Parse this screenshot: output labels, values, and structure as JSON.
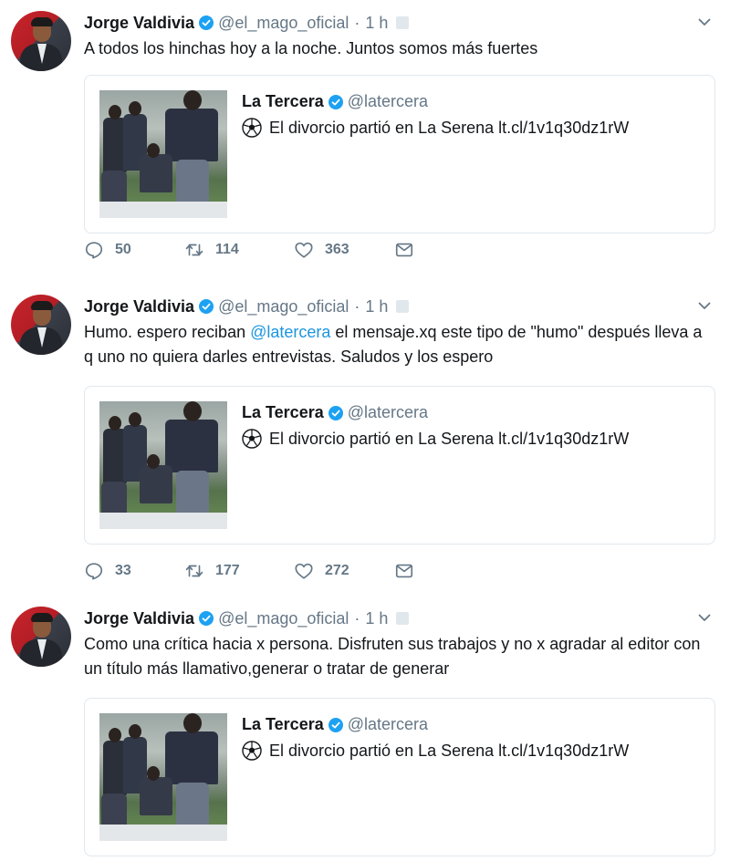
{
  "tweets": [
    {
      "name": "Jorge Valdivia",
      "handle": "@el_mago_oficial",
      "separator": "·",
      "time": "1 h",
      "text": "A todos los hinchas hoy a la noche. Juntos somos más fuertes",
      "card": {
        "name": "La Tercera",
        "handle": "@latercera",
        "text": "El divorcio partió en La Serena lt.cl/1v1q30dz1rW"
      },
      "replies": "50",
      "retweets": "114",
      "likes": "363"
    },
    {
      "name": "Jorge Valdivia",
      "handle": "@el_mago_oficial",
      "separator": "·",
      "time": "1 h",
      "text_before": "Humo. espero reciban ",
      "mention": "@latercera",
      "text_after": " el mensaje.xq este tipo de \"humo\" después lleva a q uno no quiera darles entrevistas. Saludos y los espero",
      "card": {
        "name": "La Tercera",
        "handle": "@latercera",
        "text": "El divorcio partió en La Serena lt.cl/1v1q30dz1rW"
      },
      "replies": "33",
      "retweets": "177",
      "likes": "272"
    },
    {
      "name": "Jorge Valdivia",
      "handle": "@el_mago_oficial",
      "separator": "·",
      "time": "1 h",
      "text": "Como una crítica hacia x persona. Disfruten sus trabajos y no x agradar al editor con un título más llamativo,generar o tratar de generar",
      "card": {
        "name": "La Tercera",
        "handle": "@latercera",
        "text": "El divorcio partió en La Serena lt.cl/1v1q30dz1rW"
      }
    }
  ],
  "colors": {
    "accent": "#1da1f2",
    "mention": "#1b95e0",
    "muted": "#657786",
    "border": "#e1e8ed"
  },
  "icons": [
    "verified-badge-icon",
    "chevron-down-icon",
    "reply-icon",
    "retweet-icon",
    "like-icon",
    "direct-message-icon",
    "soccer-ball-icon"
  ]
}
